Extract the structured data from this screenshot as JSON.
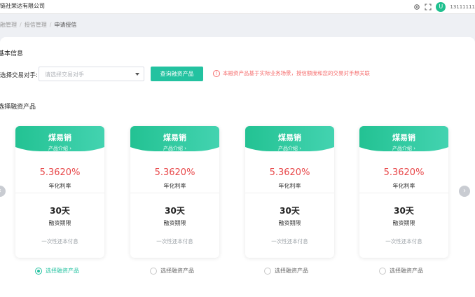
{
  "header": {
    "company": "链社荣达有限公司",
    "avatar_letter": "U",
    "phone": "13111111",
    "icons": [
      "gear-icon",
      "fullscreen-icon"
    ]
  },
  "breadcrumb": {
    "item1": "融管理",
    "item2": "授信管理",
    "item3": "申请授信",
    "sep": "/"
  },
  "basic": {
    "title": "基本信息",
    "counterparty_label": "选择交易对手:",
    "counterparty_placeholder": "请选择交易对手",
    "query_button": "查询融资产品",
    "tip": "本融资产品基于实际业务场景，授信额度和您的交易对手想关联",
    "tip_icon_glyph": "!"
  },
  "products": {
    "title": "选择融资产品",
    "select_label": "选择融资产品",
    "accent": "#23c2a0",
    "rate_color": "#e8484a",
    "selected_index": 0,
    "cards": [
      {
        "name": "煤易销",
        "intro": "产品介绍 ›",
        "rate": "5.3620%",
        "rate_label": "年化利率",
        "term": "30天",
        "term_label": "融资期限",
        "repay": "一次性还本付息"
      },
      {
        "name": "煤易销",
        "intro": "产品介绍 ›",
        "rate": "5.3620%",
        "rate_label": "年化利率",
        "term": "30天",
        "term_label": "融资期限",
        "repay": "一次性还本付息"
      },
      {
        "name": "煤易销",
        "intro": "产品介绍 ›",
        "rate": "5.3620%",
        "rate_label": "年化利率",
        "term": "30天",
        "term_label": "融资期限",
        "repay": "一次性还本付息"
      },
      {
        "name": "煤易销",
        "intro": "产品介绍 ›",
        "rate": "5.3620%",
        "rate_label": "年化利率",
        "term": "30天",
        "term_label": "融资期限",
        "repay": "一次性还本付息"
      }
    ]
  },
  "nav": {
    "prev_glyph": "‹",
    "next_glyph": "›"
  }
}
